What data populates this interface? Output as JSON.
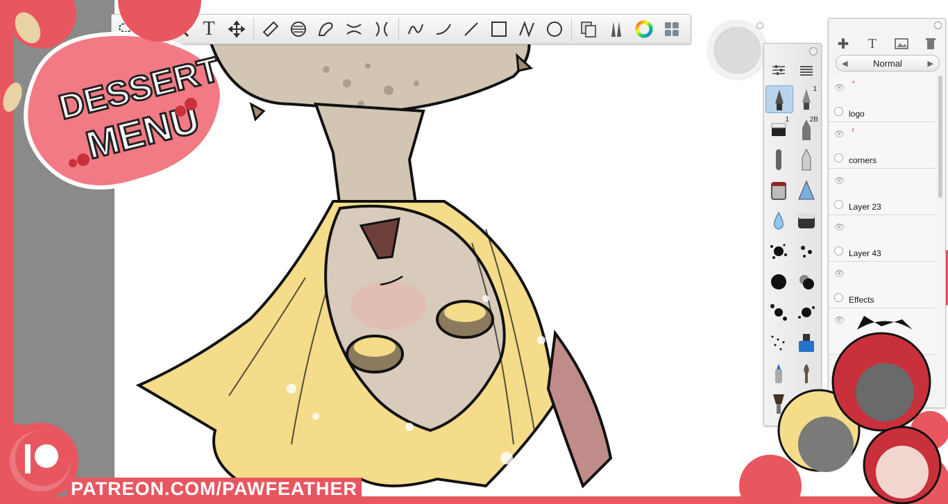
{
  "toolbar": {
    "tools": [
      "lasso",
      "crop",
      "magnifier",
      "text",
      "move",
      "ruler",
      "ellipse-guide",
      "french-curve",
      "symmetry",
      "perspective",
      "stroke-tool",
      "curve",
      "line",
      "rectangle",
      "polyline",
      "circle",
      "copy-paste",
      "brush-library",
      "color-wheel",
      "layer-grid"
    ],
    "text_tool_label": "T"
  },
  "brush_palette": {
    "brush_number_1": "1",
    "brush_number_2": "1",
    "pencil_grade": "2B"
  },
  "layers": {
    "blend_mode": "Normal",
    "items": [
      {
        "name": "logo",
        "thumb": "*"
      },
      {
        "name": "corners",
        "thumb": "r"
      },
      {
        "name": "Layer 23",
        "thumb": ""
      },
      {
        "name": "Layer 43",
        "thumb": ""
      },
      {
        "name": "Effects",
        "thumb": ""
      }
    ]
  },
  "overlay": {
    "logo_line1": "DESSERT",
    "logo_line2": "MENU",
    "patreon": "PATREON.COM/PAWFEATHER"
  },
  "colors": {
    "brand_pink": "#e8575f",
    "hair_yellow": "#f4dc8a",
    "skin": "#d9cdbc",
    "selected_tool": "#b9d3ea"
  }
}
